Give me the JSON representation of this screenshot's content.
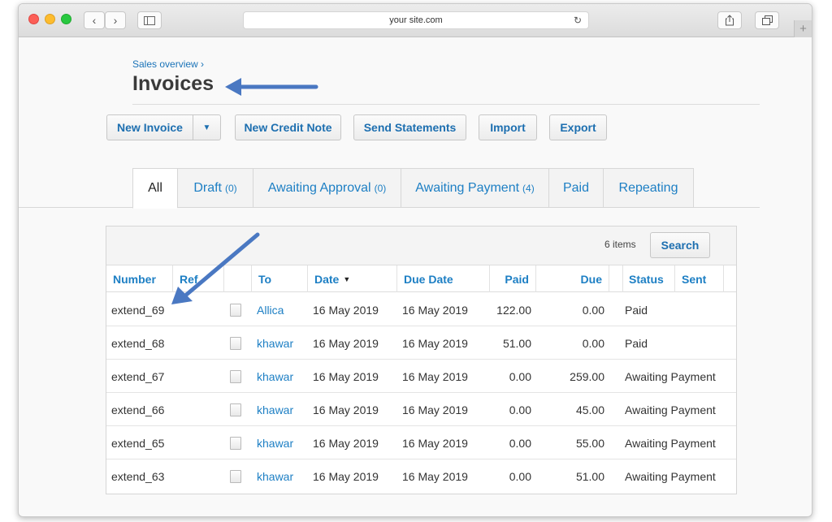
{
  "browser": {
    "url": "your site.com"
  },
  "breadcrumb": "Sales overview ›",
  "page_title": "Invoices",
  "actions": {
    "new_invoice": "New Invoice",
    "new_credit_note": "New Credit Note",
    "send_statements": "Send Statements",
    "import": "Import",
    "export": "Export"
  },
  "tabs": [
    {
      "label": "All",
      "count": ""
    },
    {
      "label": "Draft",
      "count": "(0)"
    },
    {
      "label": "Awaiting Approval",
      "count": "(0)"
    },
    {
      "label": "Awaiting Payment",
      "count": "(4)"
    },
    {
      "label": "Paid",
      "count": ""
    },
    {
      "label": "Repeating",
      "count": ""
    }
  ],
  "list": {
    "items_count": "6 items",
    "search_label": "Search",
    "columns": [
      "Number",
      "Ref",
      "",
      "To",
      "Date",
      "Due Date",
      "Paid",
      "Due",
      "",
      "Status",
      "Sent"
    ],
    "rows": [
      {
        "number": "extend_69",
        "ref": "",
        "to": "Allica",
        "date": "16 May 2019",
        "due_date": "16 May 2019",
        "paid": "122.00",
        "due": "0.00",
        "status": "Paid",
        "sent": ""
      },
      {
        "number": "extend_68",
        "ref": "",
        "to": "khawar",
        "date": "16 May 2019",
        "due_date": "16 May 2019",
        "paid": "51.00",
        "due": "0.00",
        "status": "Paid",
        "sent": ""
      },
      {
        "number": "extend_67",
        "ref": "",
        "to": "khawar",
        "date": "16 May 2019",
        "due_date": "16 May 2019",
        "paid": "0.00",
        "due": "259.00",
        "status": "Awaiting Payment",
        "sent": ""
      },
      {
        "number": "extend_66",
        "ref": "",
        "to": "khawar",
        "date": "16 May 2019",
        "due_date": "16 May 2019",
        "paid": "0.00",
        "due": "45.00",
        "status": "Awaiting Payment",
        "sent": ""
      },
      {
        "number": "extend_65",
        "ref": "",
        "to": "khawar",
        "date": "16 May 2019",
        "due_date": "16 May 2019",
        "paid": "0.00",
        "due": "55.00",
        "status": "Awaiting Payment",
        "sent": ""
      },
      {
        "number": "extend_63",
        "ref": "",
        "to": "khawar",
        "date": "16 May 2019",
        "due_date": "16 May 2019",
        "paid": "0.00",
        "due": "51.00",
        "status": "Awaiting Payment",
        "sent": ""
      }
    ]
  },
  "colors": {
    "link": "#1d7fc4",
    "annotation_arrow": "#4a78c2"
  }
}
